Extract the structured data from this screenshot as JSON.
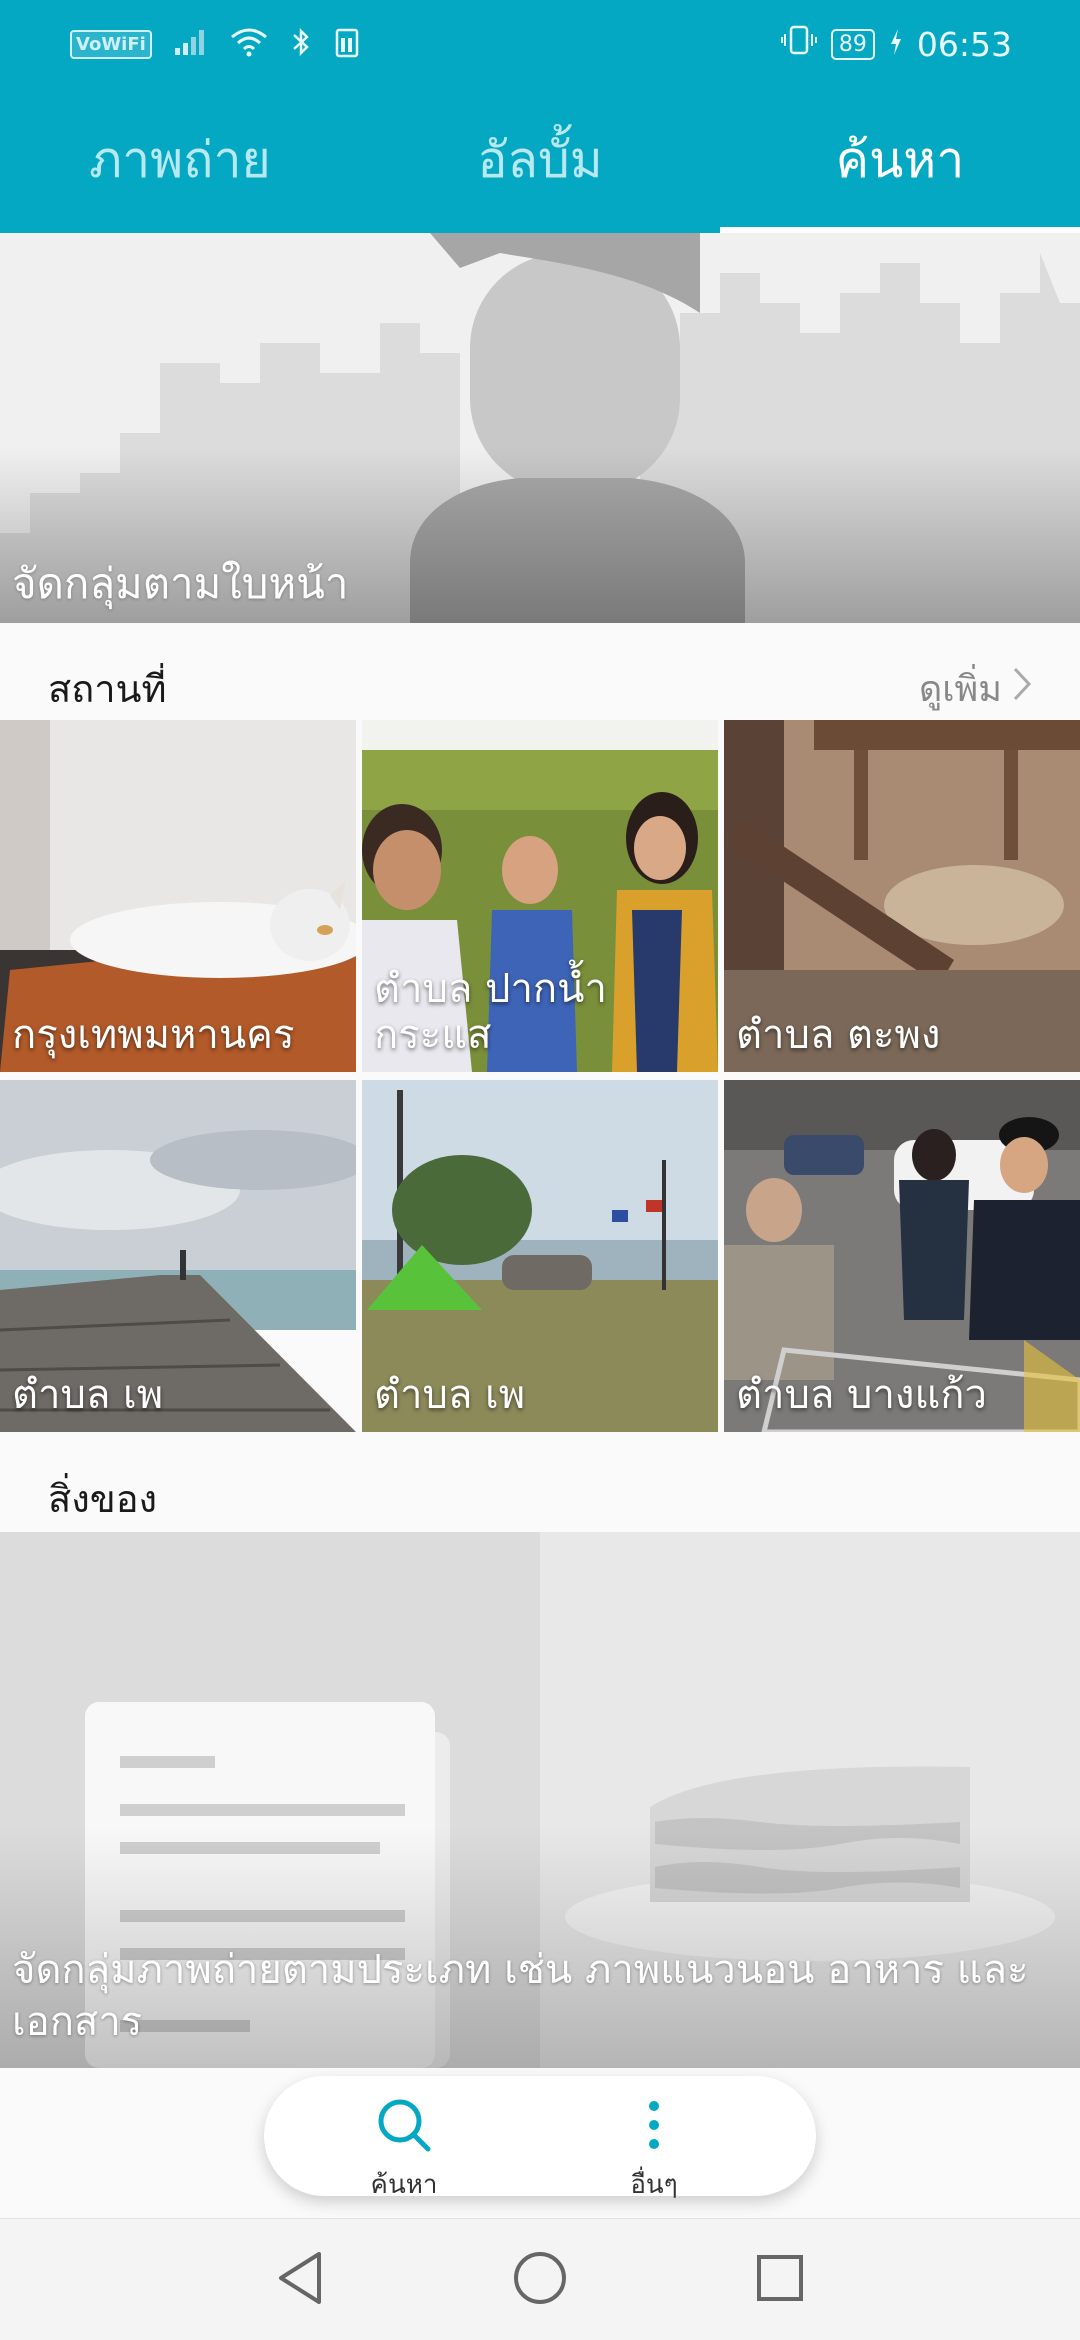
{
  "status_bar": {
    "wifi_badge": "VoWiFi",
    "battery_level": "89",
    "time": "06:53"
  },
  "tabs": [
    {
      "label": "ภาพถ่าย",
      "active": false
    },
    {
      "label": "อัลบั้ม",
      "active": false
    },
    {
      "label": "ค้นหา",
      "active": true
    }
  ],
  "faces": {
    "label": "จัดกลุ่มตามใบหน้า"
  },
  "places": {
    "title": "สถานที่",
    "more_label": "ดูเพิ่ม",
    "items": [
      {
        "label": "กรุงเทพมหานคร"
      },
      {
        "label": "ตำบล ปากน้ำกระแส"
      },
      {
        "label": "ตำบล ตะพง"
      },
      {
        "label": "ตำบล เพ"
      },
      {
        "label": "ตำบล เพ"
      },
      {
        "label": "ตำบล บางแก้ว"
      }
    ]
  },
  "things": {
    "title": "สิ่งของ",
    "label": "จัดกลุ่มภาพถ่ายตามประเภท เช่น ภาพแนวนอน อาหาร และเอกสาร"
  },
  "bottom_actions": [
    {
      "label": "ค้นหา",
      "icon": "search-icon"
    },
    {
      "label": "อื่นๆ",
      "icon": "more-vertical-icon"
    }
  ],
  "nav": {
    "back_icon": "back-triangle-icon",
    "home_icon": "home-circle-icon",
    "recents_icon": "recents-square-icon"
  },
  "colors": {
    "accent": "#05a8c3",
    "background": "#fafafa"
  }
}
